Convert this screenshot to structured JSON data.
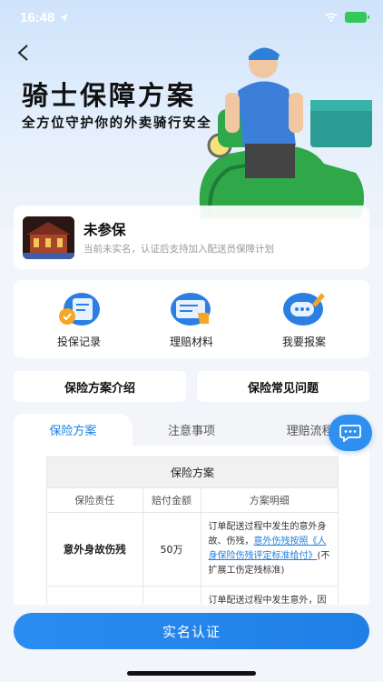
{
  "status_bar": {
    "time": "16:48"
  },
  "hero": {
    "title": "骑士保障方案",
    "subtitle": "全方位守护你的外卖骑行安全"
  },
  "user": {
    "name": "未参保",
    "description": "当前未实名，认证后支持加入配送员保障计划"
  },
  "actions": [
    {
      "label": "投保记录",
      "icon": "policy-record-icon"
    },
    {
      "label": "理赔材料",
      "icon": "claim-materials-icon"
    },
    {
      "label": "我要报案",
      "icon": "report-case-icon"
    }
  ],
  "section_tabs": [
    {
      "label": "保险方案介绍"
    },
    {
      "label": "保险常见问题"
    }
  ],
  "content_tabs": [
    {
      "label": "保险方案",
      "active": true
    },
    {
      "label": "注意事项",
      "active": false
    },
    {
      "label": "理赔流程",
      "active": false
    }
  ],
  "table": {
    "title": "保险方案",
    "headers": [
      "保险责任",
      "赔付金额",
      "方案明细"
    ],
    "rows": [
      {
        "liability": "意外身故伤残",
        "amount": "50万",
        "detail_prefix": "订单配送过程中发生的意外身故、伤残，",
        "detail_link": "意外伤残按照《人身保险伤残评定标准给付》",
        "detail_suffix": "(不扩展工伤定残标准)"
      },
      {
        "liability": "",
        "amount": "",
        "detail_prefix": "订单配送过程中发生意外，因治疗需要产生的合理且必",
        "detail_link": "",
        "detail_suffix": ""
      }
    ]
  },
  "primary_button": {
    "label": "实名认证"
  },
  "colors": {
    "accent": "#1e7fe0",
    "button": "#2a8cf0",
    "battery": "#34c759"
  }
}
